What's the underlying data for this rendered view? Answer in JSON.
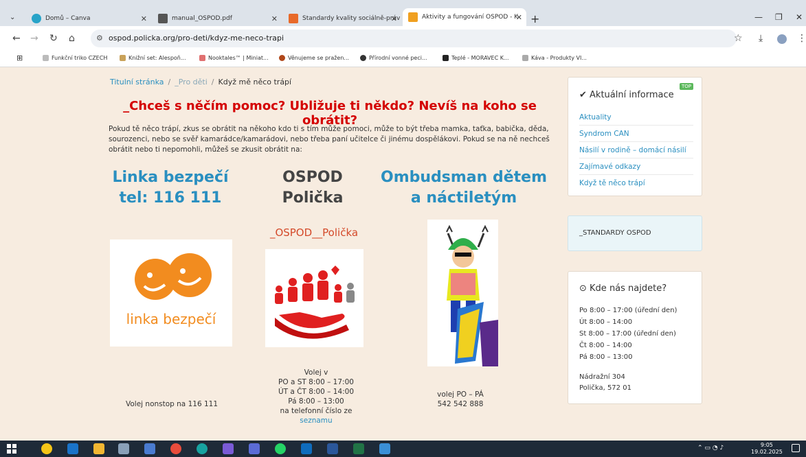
{
  "browser": {
    "tabs": [
      {
        "label": "Domů – Canva",
        "active": false
      },
      {
        "label": "manual_OSPOD.pdf",
        "active": false
      },
      {
        "label": "Standardy kvality sociálně-práv",
        "active": false
      },
      {
        "label": "Aktivity a fungování OSPOD - K",
        "active": true
      }
    ],
    "url": "ospod.policka.org/pro-deti/kdyz-me-neco-trapi",
    "bookmarks": [
      "Funkční triko CZECH",
      "Knižní set: Alespoň...",
      "Nooktales™ | Miniat...",
      "Věnujeme se pražen...",
      "Přírodní vonné peci...",
      "Teplé - MORAVEC K...",
      "Káva - Produkty VI..."
    ],
    "profile_initial": "T"
  },
  "breadcrumb": {
    "home": "Titulní stránka",
    "section": "_Pro děti",
    "current": "Když mě něco trápí"
  },
  "heading": "_Chceš s něčím pomoc? Ubližuje ti někdo? Nevíš na koho se obrátit?",
  "intro": "Pokud tě něco trápí, zkus se obrátit na někoho kdo ti s tím může pomoci, může to být třeba mamka, taťka, babička, děda, sourozenci, nebo se svěř kamarádce/kamarádovi, nebo třeba paní učitelce či jinému dospělákovi. Pokud se na ně nechceš obrátit nebo ti nepomohli, můžeš se zkusit obrátit na:",
  "columns": {
    "linka": {
      "title1": "Linka bezpečí",
      "title2": "tel: 116 111",
      "logo_text": "linka bezpečí",
      "contact": "Volej nonstop na  116 111"
    },
    "ospod": {
      "title1": "OSPOD",
      "title2": "Polička",
      "subtitle": "_OSPOD__Polička",
      "contact_lines": [
        "Volej v",
        "PO a ST 8:00 – 17:00",
        "ÚT a ČT 8:00 – 14:00",
        "Pá 8:00 – 13:00",
        "na telefonní číslo ze"
      ],
      "contact_link": "seznamu"
    },
    "ombudsman": {
      "title1": "Ombudsman dětem",
      "title2": "a náctiletým",
      "contact_lines": [
        "volej PO – PÁ",
        "542 542 888"
      ]
    }
  },
  "sidebar": {
    "info_title": "Aktuální informace",
    "top_badge": "TOP",
    "links": [
      "Aktuality",
      "Syndrom CAN",
      "Násilí v rodině – domácí násilí",
      "Zajímavé odkazy",
      "Když tě něco trápí"
    ],
    "standards": "_STANDARDY OSPOD",
    "where_title": "Kde nás najdete?",
    "hours": [
      "Po 8:00 – 17:00  (úřední den)",
      "Út 8:00 – 14:00",
      "St  8:00 – 17:00  (úřední den)",
      "Čt 8:00 – 14:00",
      "Pá 8:00 – 13:00"
    ],
    "address": [
      "Nádražní 304",
      "Polička, 572 01"
    ]
  },
  "taskbar": {
    "time": "9:05",
    "date": "19.02.2025"
  }
}
